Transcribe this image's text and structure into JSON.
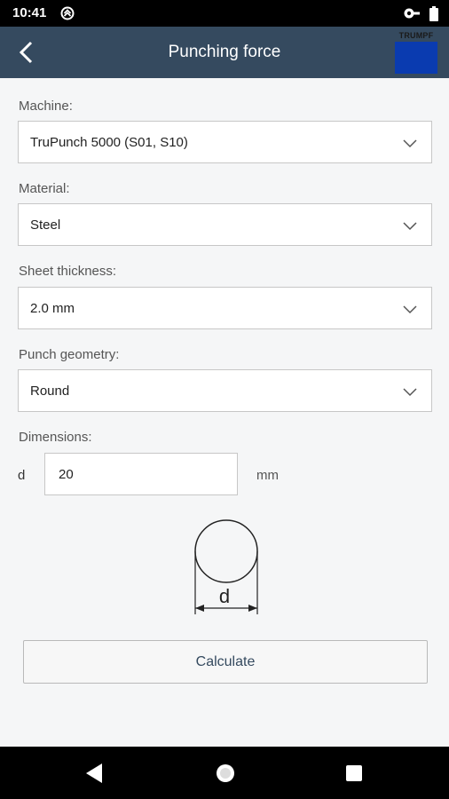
{
  "status_bar": {
    "time": "10:41"
  },
  "header": {
    "title": "Punching force",
    "logo_text": "TRUMPF"
  },
  "form": {
    "machine": {
      "label": "Machine:",
      "value": "TruPunch 5000 (S01, S10)"
    },
    "material": {
      "label": "Material:",
      "value": "Steel"
    },
    "thickness": {
      "label": "Sheet thickness:",
      "value": "2.0 mm"
    },
    "geometry": {
      "label": "Punch geometry:",
      "value": "Round"
    },
    "dimensions": {
      "label": "Dimensions:",
      "field_label": "d",
      "value": "20",
      "unit": "mm"
    },
    "diagram_label": "d"
  },
  "actions": {
    "calculate_label": "Calculate"
  },
  "colors": {
    "header_bg": "#354a5f",
    "logo_blue": "#0a3bb0"
  }
}
